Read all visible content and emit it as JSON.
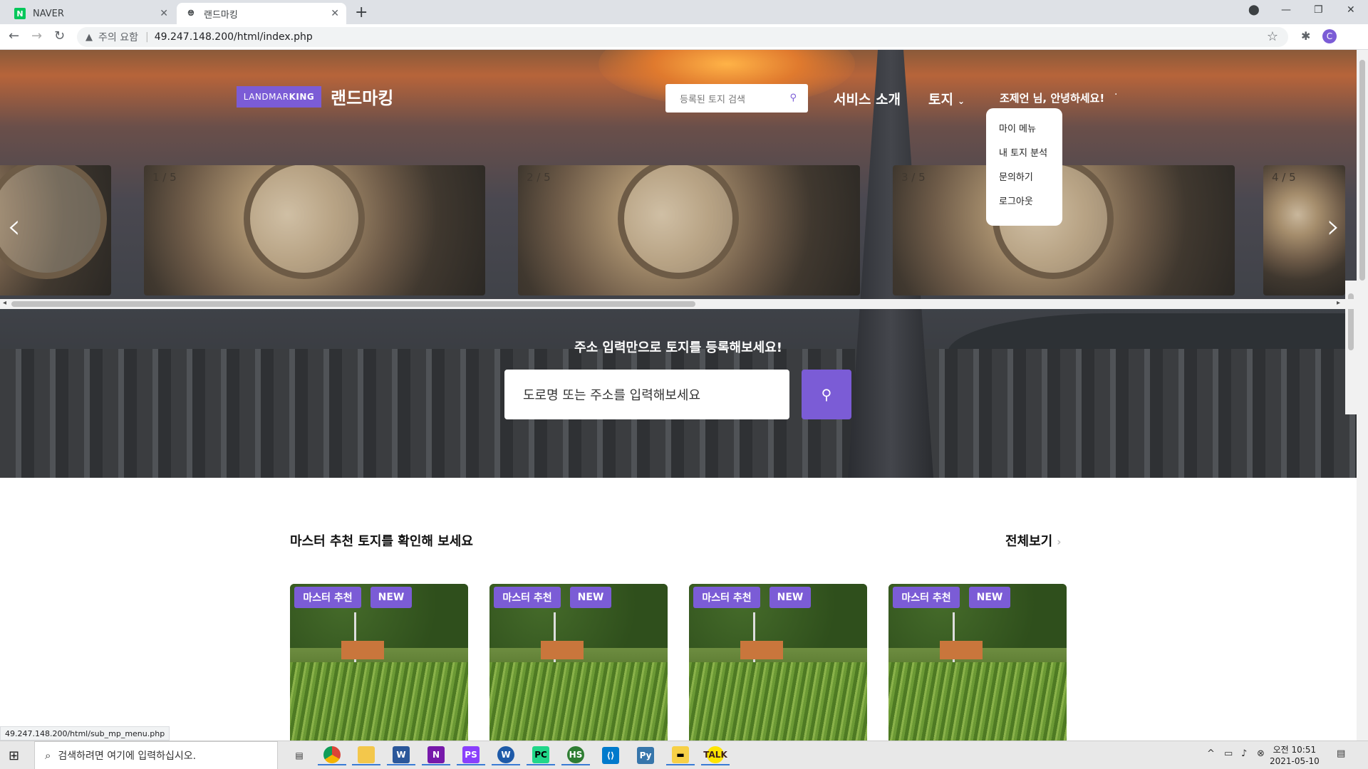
{
  "browser": {
    "tabs": [
      {
        "label": "NAVER",
        "favicon": "N"
      },
      {
        "label": "랜드마킹"
      }
    ],
    "new_tab": "+",
    "address": {
      "warning": "주의 요함",
      "separator": "|",
      "url": "49.247.148.200/html/index.php"
    },
    "profile_initial": "C",
    "status_url": "49.247.148.200/html/sub_mp_menu.php"
  },
  "header": {
    "logo_prefix": "LANDMAR",
    "logo_suffix": "KING",
    "brand": "랜드마킹",
    "search_placeholder": "등록된 토지 검색",
    "nav": {
      "service": "서비스 소개",
      "land": "토지",
      "user": "조제언 님, 안녕하세요!"
    }
  },
  "dropdown": {
    "items": [
      "마이 메뉴",
      "내 토지 분석",
      "문의하기",
      "로그아웃"
    ]
  },
  "carousel": {
    "slides": [
      "1 / 5",
      "2 / 5",
      "3 / 5",
      "4 / 5"
    ]
  },
  "register": {
    "title": "주소 입력만으로 토지를 등록해보세요!",
    "placeholder": "도로명 또는 주소를 입력해보세요"
  },
  "recommend": {
    "title": "마스터 추천 토지를 확인해 보세요",
    "view_all": "전체보기",
    "cards": [
      {
        "badge1": "마스터 추천",
        "badge2": "NEW"
      },
      {
        "badge1": "마스터 추천",
        "badge2": "NEW"
      },
      {
        "badge1": "마스터 추천",
        "badge2": "NEW"
      },
      {
        "badge1": "마스터 추천",
        "badge2": "NEW"
      }
    ]
  },
  "taskbar": {
    "search_placeholder": "검색하려면 여기에 입력하십시오.",
    "time": "오전 10:51",
    "date": "2021-05-10",
    "apps": [
      "chrome",
      "file-explorer",
      "word",
      "onenote",
      "phpstorm",
      "writer",
      "pycharm",
      "hs",
      "vscode",
      "python",
      "sticky-notes",
      "kakaotalk"
    ]
  },
  "colors": {
    "accent": "#7b5cd6"
  }
}
